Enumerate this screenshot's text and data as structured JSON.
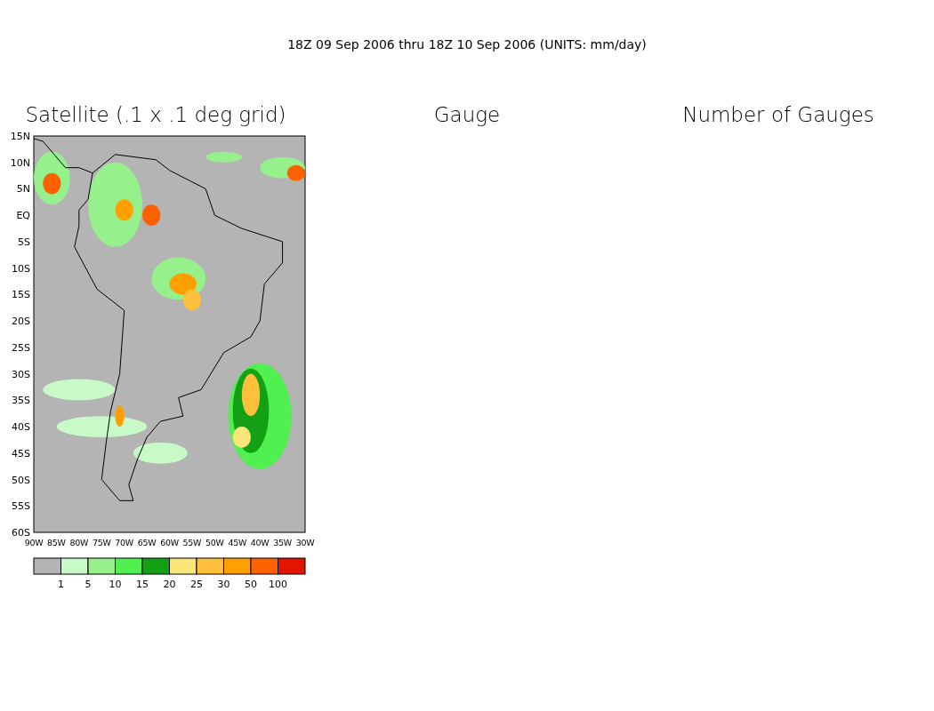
{
  "title": "18Z 09 Sep 2006 thru 18Z 10 Sep 2006 (UNITS: mm/day)",
  "panels": [
    {
      "title": "Satellite (.1 x .1 deg grid)",
      "kind": "map"
    },
    {
      "title": "Gauge",
      "kind": "empty"
    },
    {
      "title": "Number of Gauges",
      "kind": "empty"
    }
  ],
  "map": {
    "lat_labels": [
      "15N",
      "10N",
      "5N",
      "EQ",
      "5S",
      "10S",
      "15S",
      "20S",
      "25S",
      "30S",
      "35S",
      "40S",
      "45S",
      "50S",
      "55S",
      "60S"
    ],
    "lon_labels": [
      "90W",
      "85W",
      "80W",
      "75W",
      "70W",
      "65W",
      "60W",
      "55W",
      "50W",
      "45W",
      "40W",
      "35W",
      "30W"
    ]
  },
  "colorbar": {
    "bins": [
      {
        "color": "#b4b4b4"
      },
      {
        "color": "#c8fac8"
      },
      {
        "color": "#96f08c"
      },
      {
        "color": "#50f050"
      },
      {
        "color": "#14a014"
      },
      {
        "color": "#fae678"
      },
      {
        "color": "#ffc03c"
      },
      {
        "color": "#ffa000"
      },
      {
        "color": "#ff6000"
      },
      {
        "color": "#e11400"
      }
    ],
    "labels": [
      "1",
      "5",
      "10",
      "15",
      "20",
      "25",
      "30",
      "50",
      "100"
    ]
  }
}
